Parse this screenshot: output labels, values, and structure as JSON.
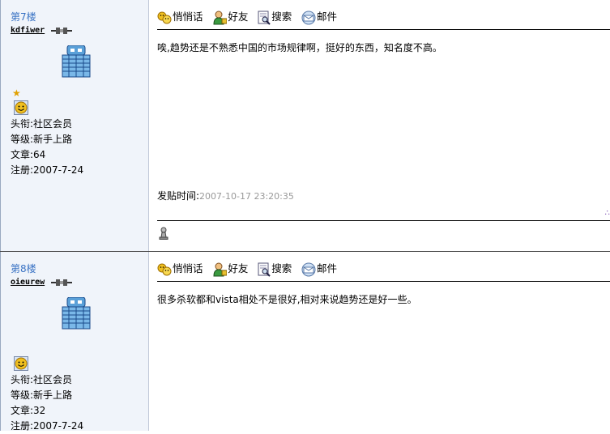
{
  "posts": [
    {
      "floor": "第7楼",
      "username": "kdfiwer",
      "has_star": true,
      "title_label": "头衔:社区会员",
      "level_label": "等级:新手上路",
      "posts_label": "文章:64",
      "reg_label": "注册:2007-7-24",
      "toolbar": {
        "whisper": "悄悄话",
        "friend": "好友",
        "search": "搜索",
        "mail": "邮件"
      },
      "content": "唉,趋势还是不熟悉中国的市场规律啊，挺好的东西，知名度不高。",
      "posted_label": "发贴时间:",
      "posted_time": "2007-10-17 23:20:35",
      "corner_mark": "∴"
    },
    {
      "floor": "第8楼",
      "username": "oieurew",
      "has_star": false,
      "title_label": "头衔:社区会员",
      "level_label": "等级:新手上路",
      "posts_label": "文章:32",
      "reg_label": "注册:2007-7-24",
      "toolbar": {
        "whisper": "悄悄话",
        "friend": "好友",
        "search": "搜索",
        "mail": "邮件"
      },
      "content": "很多杀软都和vista相处不是很好,相对来说趋势还是好一些。"
    }
  ],
  "colors": {
    "sidebar_bg": "#f0f4fa",
    "floor_link": "#3a73c4",
    "time_gray": "#999999"
  }
}
